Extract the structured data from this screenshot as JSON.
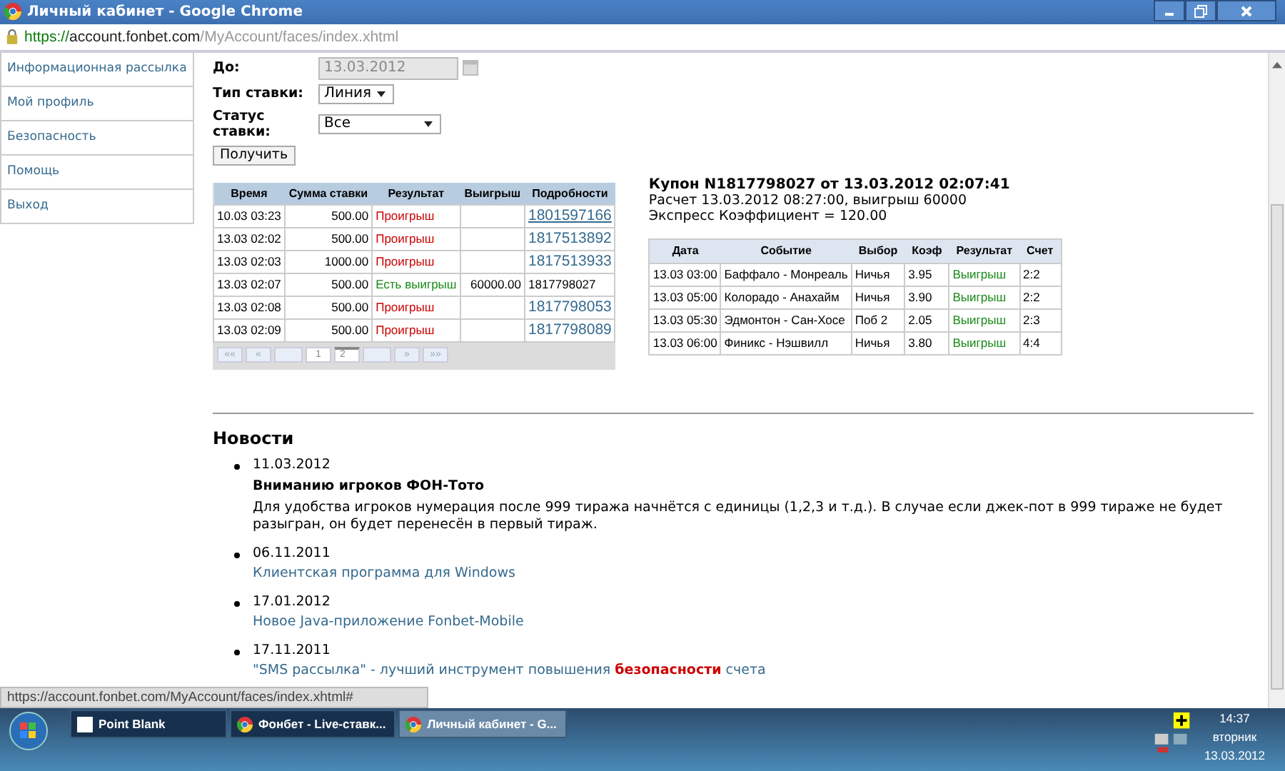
{
  "window": {
    "title": "Личный кабинет - Google Chrome"
  },
  "address_bar": {
    "secure": true,
    "scheme": "https://",
    "host": "account.fonbet.com",
    "path": "/MyAccount/faces/index.xhtml"
  },
  "sidebar": {
    "items": [
      {
        "label": "Информационная рассылка"
      },
      {
        "label": "Мой профиль"
      },
      {
        "label": "Безопасность"
      },
      {
        "label": "Помощь"
      },
      {
        "label": "Выход"
      }
    ]
  },
  "filters": {
    "date_to": {
      "label": "До:",
      "value": "13.03.2012",
      "disabled": true
    },
    "bet_type": {
      "label": "Тип ставки:",
      "value": "Линия"
    },
    "bet_status": {
      "label": "Статус ставки:",
      "value": "Все"
    },
    "submit": "Получить"
  },
  "bets_table": {
    "columns": [
      "Время",
      "Сумма ставки",
      "Результат",
      "Выигрыш",
      "Подробности"
    ],
    "rows": [
      {
        "time": "10.03 03:23",
        "amount": "500.00",
        "result": "Проигрыш",
        "won": false,
        "payout": "",
        "details": "1801597166",
        "link": true
      },
      {
        "time": "13.03 02:02",
        "amount": "500.00",
        "result": "Проигрыш",
        "won": false,
        "payout": "",
        "details": "1817513892",
        "link": true
      },
      {
        "time": "13.03 02:03",
        "amount": "1000.00",
        "result": "Проигрыш",
        "won": false,
        "payout": "",
        "details": "1817513933",
        "link": true
      },
      {
        "time": "13.03 02:07",
        "amount": "500.00",
        "result": "Есть выигрыш",
        "won": true,
        "payout": "60000.00",
        "details": "1817798027",
        "link": false
      },
      {
        "time": "13.03 02:08",
        "amount": "500.00",
        "result": "Проигрыш",
        "won": false,
        "payout": "",
        "details": "1817798053",
        "link": true
      },
      {
        "time": "13.03 02:09",
        "amount": "500.00",
        "result": "Проигрыш",
        "won": false,
        "payout": "",
        "details": "1817798089",
        "link": true
      }
    ],
    "pager": [
      {
        "label": "««",
        "kind": "nav",
        "selected": false
      },
      {
        "label": "«",
        "kind": "nav",
        "selected": false
      },
      {
        "kind": "blank",
        "selected": false
      },
      {
        "label": "1",
        "kind": "page",
        "selected": false
      },
      {
        "label": "2",
        "kind": "page",
        "selected": true
      },
      {
        "kind": "blank",
        "selected": false
      },
      {
        "label": "»",
        "kind": "nav",
        "selected": false
      },
      {
        "label": "»»",
        "kind": "nav",
        "selected": false
      }
    ]
  },
  "coupon": {
    "title": "Купон N1817798027 от 13.03.2012 02:07:41",
    "settlement": "Расчет 13.03.2012 08:27:00, выигрыш 60000",
    "express": "Экспресс Коэффициент = 120.00",
    "columns": [
      "Дата",
      "Событие",
      "Выбор",
      "Коэф",
      "Результат",
      "Счет"
    ],
    "rows": [
      {
        "date": "13.03 03:00",
        "event": "Баффало - Монреаль",
        "choice": "Ничья",
        "odds": "3.95",
        "result": "Выигрыш",
        "score": "2:2"
      },
      {
        "date": "13.03 05:00",
        "event": "Колорадо - Анахайм",
        "choice": "Ничья",
        "odds": "3.90",
        "result": "Выигрыш",
        "score": "2:2"
      },
      {
        "date": "13.03 05:30",
        "event": "Эдмонтон - Сан-Хосе",
        "choice": "Поб 2",
        "odds": "2.05",
        "result": "Выигрыш",
        "score": "2:3"
      },
      {
        "date": "13.03 06:00",
        "event": "Финикс - Нэшвилл",
        "choice": "Ничья",
        "odds": "3.80",
        "result": "Выигрыш",
        "score": "4:4"
      }
    ]
  },
  "news": {
    "title": "Новости",
    "items": [
      {
        "date": "11.03.2012",
        "kind": "article",
        "headline": "Вниманию игроков ФОН-Тото",
        "text": "Для удобства игроков нумерация после 999 тиража начнётся с единицы (1,2,3 и т.д.). В случае если джек-пот в 999 тираже не будет разыгран, он будет перенесён в первый тираж."
      },
      {
        "date": "06.11.2011",
        "kind": "link",
        "text": "Клиентская программа для Windows"
      },
      {
        "date": "17.01.2012",
        "kind": "link",
        "text": "Новое Java-приложение Fonbet-Mobile"
      },
      {
        "date": "17.11.2011",
        "kind": "link",
        "text": "\"SMS рассылка\" - лучший инструмент повышения **безопасности** счета"
      }
    ]
  },
  "status_bar": {
    "url": "https://account.fonbet.com/MyAccount/faces/index.xhtml#"
  },
  "taskbar": {
    "tasks": [
      {
        "label": "Point Blank",
        "kind": "blank",
        "selected": false
      },
      {
        "label": "Фонбет - Live-ставк...",
        "kind": "chrome",
        "selected": false
      },
      {
        "label": "Личный кабинет - G...",
        "kind": "chrome",
        "selected": true
      }
    ],
    "clock": {
      "time": "14:37",
      "day": "вторник",
      "date": "13.03.2012"
    }
  }
}
